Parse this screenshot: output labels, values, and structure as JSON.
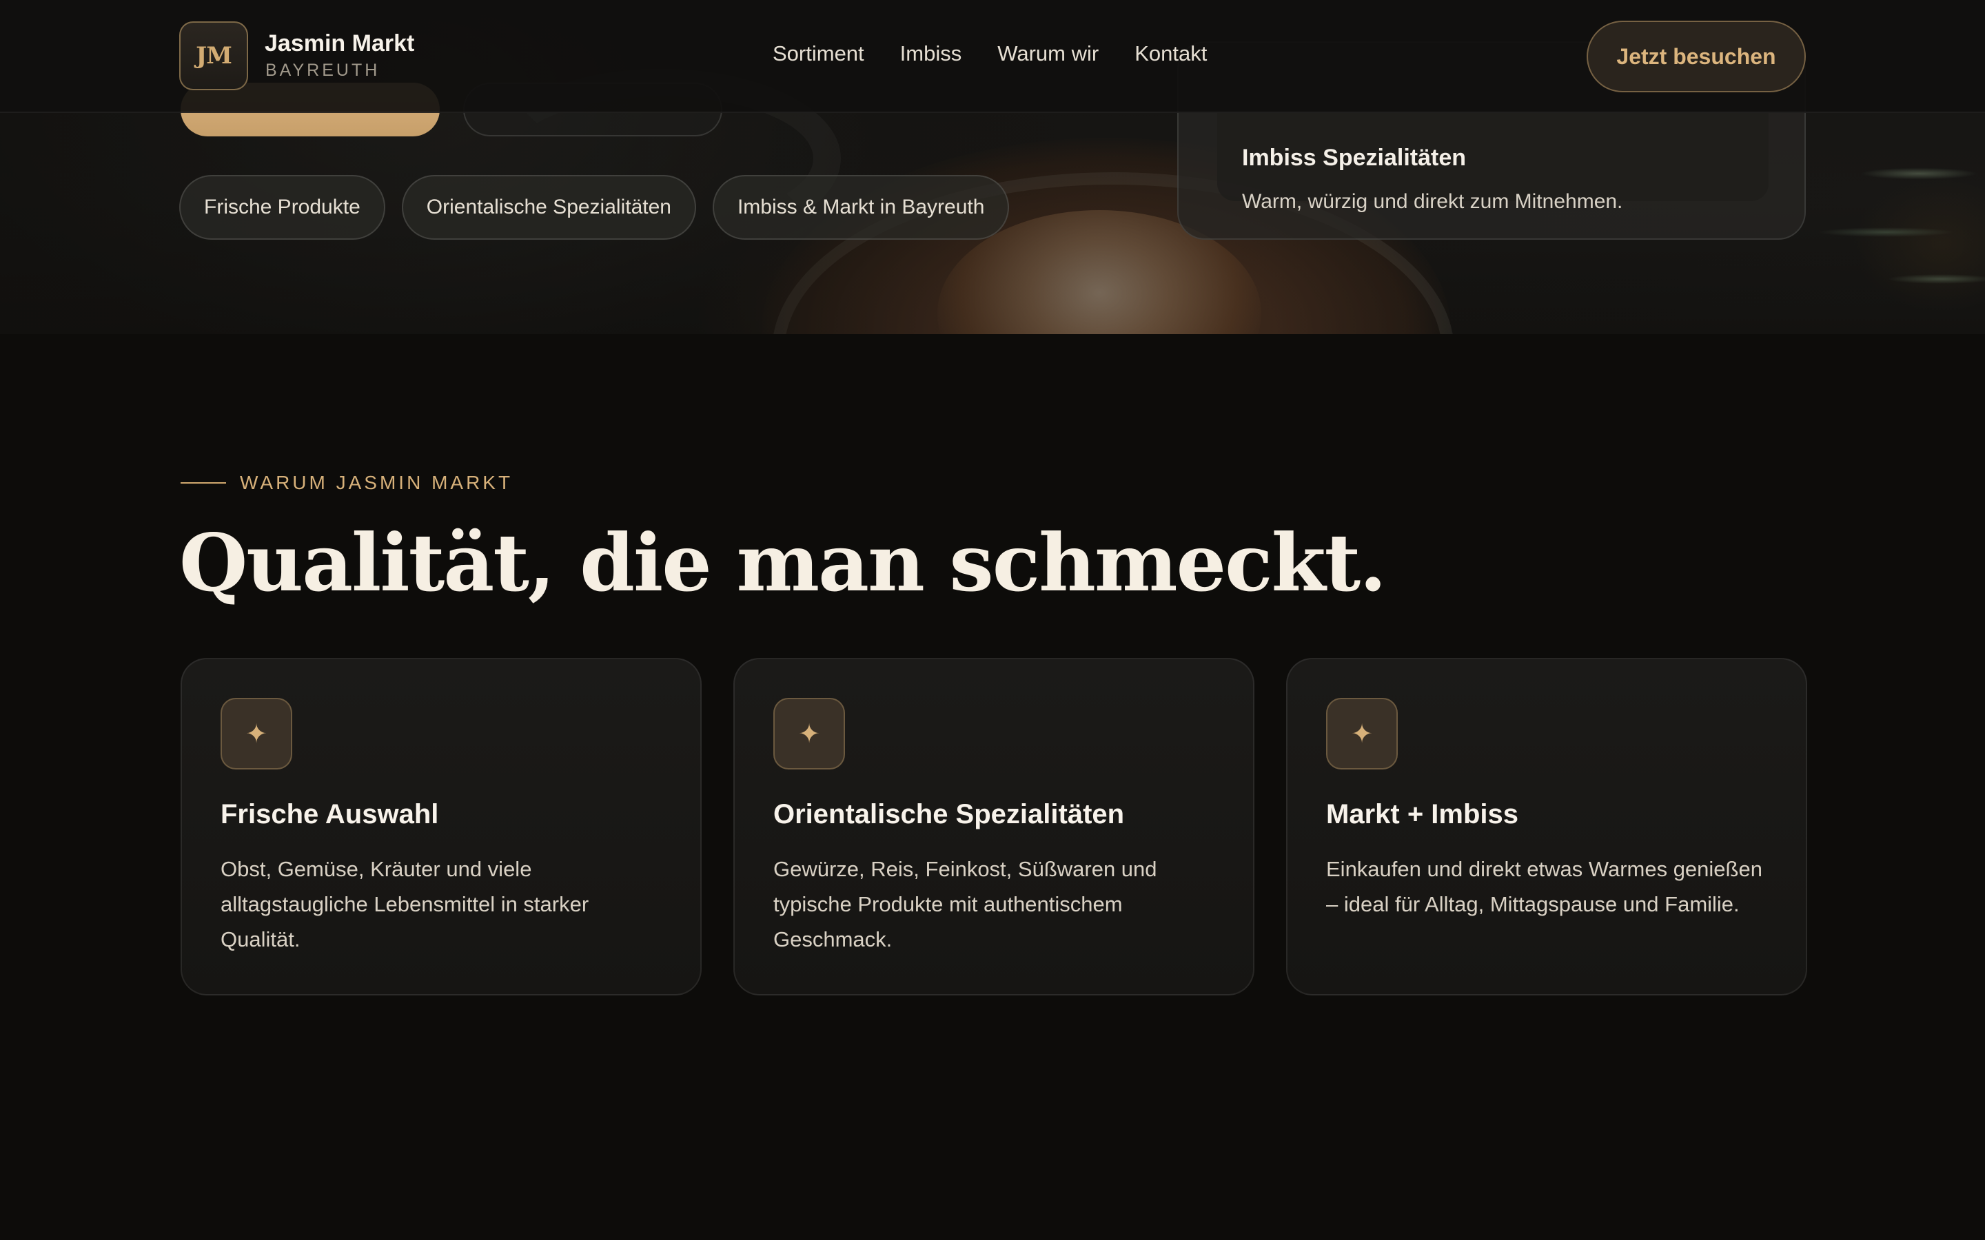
{
  "header": {
    "logo_initials": "JM",
    "brand_name": "Jasmin Markt",
    "brand_sub": "BAYREUTH",
    "nav": [
      "Sortiment",
      "Imbiss",
      "Warum wir",
      "Kontakt"
    ],
    "cta_label": "Jetzt besuchen"
  },
  "hero": {
    "chips": [
      "Frische Produkte",
      "Orientalische Spezialitäten",
      "Imbiss & Markt in Bayreuth"
    ],
    "card_title": "Imbiss Spezialitäten",
    "card_text": "Warm, würzig und direkt zum Mitnehmen."
  },
  "section": {
    "eyebrow": "WARUM JASMIN MARKT",
    "headline": "Qualität, die man schmeckt.",
    "cards": [
      {
        "icon": "sparkle-icon",
        "title": "Frische Auswahl",
        "text": "Obst, Gemüse, Kräuter und viele alltagstaugliche Lebensmittel in starker Qualität."
      },
      {
        "icon": "sparkle-icon",
        "title": "Orientalische Spezialitäten",
        "text": "Gewürze, Reis, Feinkost, Süßwaren und typische Produkte mit authentischem Geschmack."
      },
      {
        "icon": "sparkle-icon",
        "title": "Markt + Imbiss",
        "text": "Einkaufen und direkt etwas Warmes genießen – ideal für Alltag, Mittagspause und Familie."
      }
    ]
  },
  "colors": {
    "accent": "#d7b17a",
    "background": "#0d0c0a",
    "card": "#1a1917"
  }
}
